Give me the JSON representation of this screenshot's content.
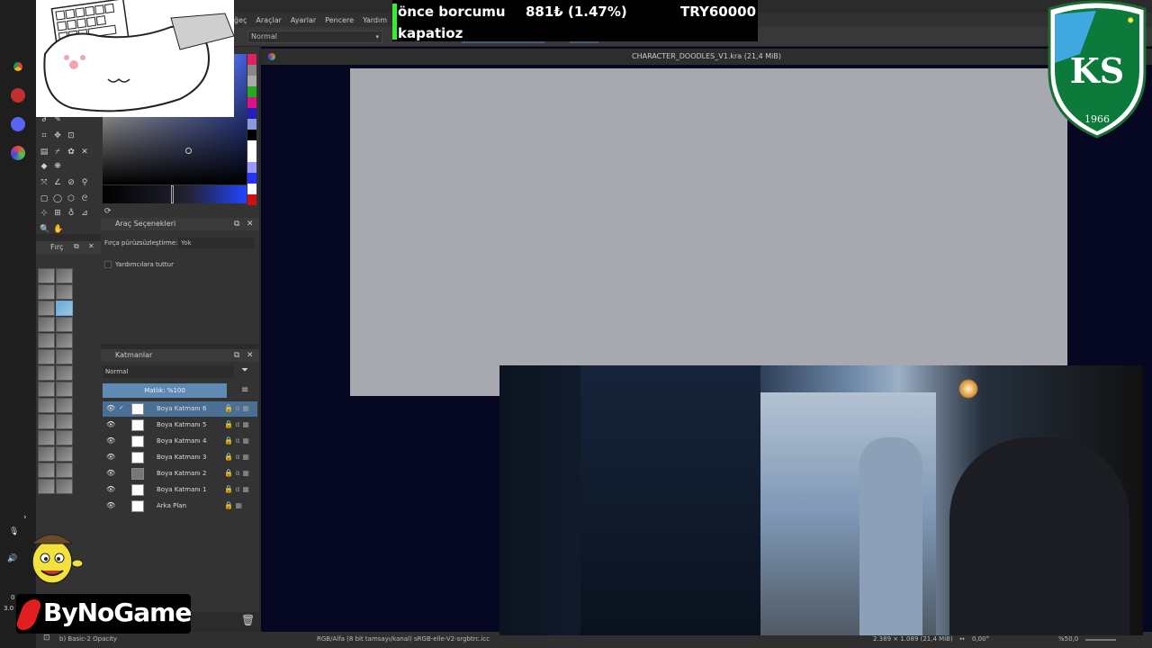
{
  "menubar": {
    "items": [
      "ğeç",
      "Araçlar",
      "Ayarlar",
      "Pencere",
      "Yardım"
    ]
  },
  "toolbar": {
    "blend_mode": "Normal"
  },
  "document": {
    "tab_title": "CHARACTER_DOODLES_V1.kra (21,4 MiB)"
  },
  "tool_options": {
    "title": "Araç Seçenekleri",
    "smoothing_label": "Fırça pürüzsüzleştirme:",
    "smoothing_value": "Yok",
    "assistant_label": "Yardımcılara tuttur"
  },
  "brush_docker": {
    "title": "Fırç"
  },
  "layers": {
    "title": "Katmanlar",
    "blend_mode": "Normal",
    "opacity": "Matlık: %100",
    "items": [
      {
        "name": "Boya Katmanı 6",
        "active": true,
        "locked": false
      },
      {
        "name": "Boya Katmanı 5",
        "active": false,
        "locked": false
      },
      {
        "name": "Boya Katmanı 4",
        "active": false,
        "locked": false
      },
      {
        "name": "Boya Katmanı 3",
        "active": false,
        "locked": false
      },
      {
        "name": "Boya Katmanı 2",
        "active": false,
        "locked": false
      },
      {
        "name": "Boya Katmanı 1",
        "active": false,
        "locked": false
      },
      {
        "name": "Arka Plan",
        "active": false,
        "locked": true
      }
    ]
  },
  "statusbar": {
    "brush": "b) Basic-2 Opacity",
    "color_space": "RGB/Alfa (8 bit tamsayı/kanal) sRGB-elle-V2-srgbtrc.icc",
    "dimensions": "2.389 × 1.089 (21,4 MiB)",
    "rotation": "0,00°",
    "zoom": "%50,0"
  },
  "ticker": {
    "line1_label": "önce borcumu",
    "line1_value": "881₺ (1.47%)",
    "line1_goal": "TRY60000",
    "line2": "kapatioz"
  },
  "crest": {
    "letters": "KS",
    "year": "1966"
  },
  "overlay_logo": {
    "text": "ByNoGame"
  },
  "tray": {
    "num1": "0",
    "num2": "3.0"
  },
  "colors": {
    "accent": "#5e8ab4",
    "canvas_bg": "#060720",
    "artboard": "#a7a8b0",
    "ticker_green": "#33ee33"
  }
}
